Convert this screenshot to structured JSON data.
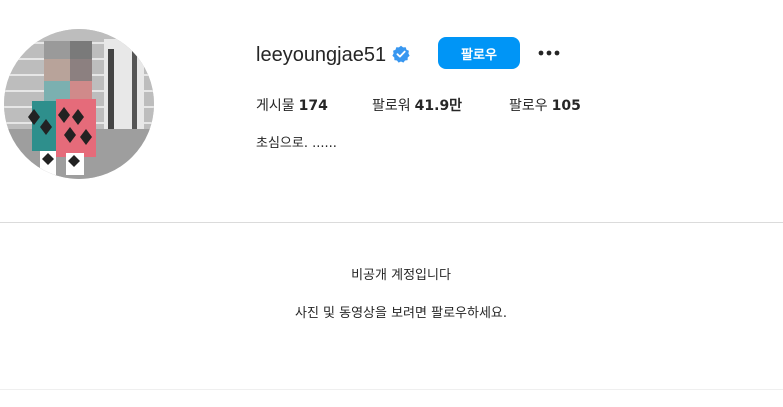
{
  "profile": {
    "username": "leeyoungjae51",
    "verified": true,
    "follow_label": "팔로우",
    "more_icon": "ellipsis-icon",
    "stats": [
      {
        "label": "게시물",
        "value": "174"
      },
      {
        "label": "팔로워",
        "value": "41.9만"
      },
      {
        "label": "팔로우",
        "value": "105"
      }
    ],
    "bio": "초심으로. ......"
  },
  "private_notice": {
    "title": "비공개 계정입니다",
    "description": "사진 및 동영상을 보려면 팔로우하세요."
  },
  "colors": {
    "accent": "#0095f6",
    "verified_badge": "#3897f0",
    "text": "#262626",
    "divider": "#dbdbdb"
  }
}
